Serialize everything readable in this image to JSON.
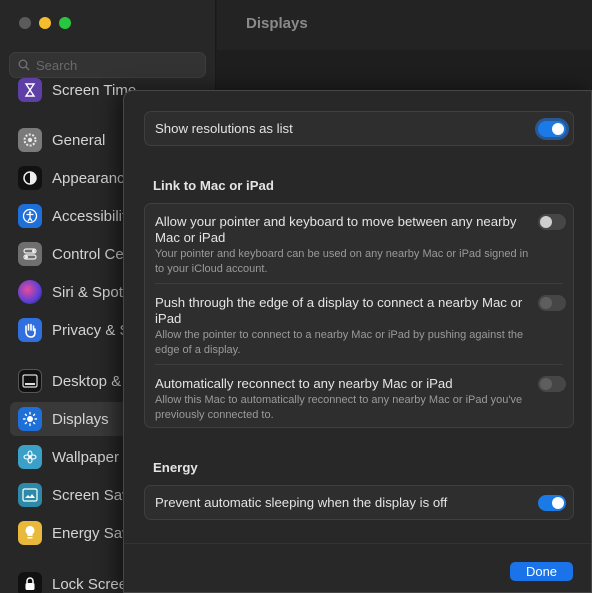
{
  "window": {
    "title": "Displays"
  },
  "search": {
    "placeholder": "Search"
  },
  "sidebar": {
    "items": [
      {
        "label": "Screen Time",
        "icon": "hourglass-icon"
      },
      {
        "label": "General",
        "icon": "gear-icon"
      },
      {
        "label": "Appearance",
        "icon": "appearance-icon"
      },
      {
        "label": "Accessibility",
        "icon": "accessibility-icon"
      },
      {
        "label": "Control Centre",
        "icon": "control-centre-icon"
      },
      {
        "label": "Siri & Spotlight",
        "icon": "siri-icon"
      },
      {
        "label": "Privacy & Security",
        "icon": "hand-icon"
      },
      {
        "label": "Desktop & Dock",
        "icon": "dock-icon"
      },
      {
        "label": "Displays",
        "icon": "display-brightness-icon"
      },
      {
        "label": "Wallpaper",
        "icon": "wallpaper-icon"
      },
      {
        "label": "Screen Saver",
        "icon": "screen-saver-icon"
      },
      {
        "label": "Energy Saver",
        "icon": "lightbulb-icon"
      },
      {
        "label": "Lock Screen",
        "icon": "lock-icon"
      }
    ]
  },
  "sheet": {
    "show_resolutions": {
      "label": "Show resolutions as list",
      "enabled": true
    },
    "link_section": {
      "title": "Link to Mac or iPad",
      "rows": [
        {
          "title": "Allow your pointer and keyboard to move between any nearby Mac or iPad",
          "description": "Your pointer and keyboard can be used on any nearby Mac or iPad signed in to your iCloud account.",
          "enabled": false
        },
        {
          "title": "Push through the edge of a display to connect a nearby Mac or iPad",
          "description": "Allow the pointer to connect to a nearby Mac or iPad by pushing against the edge of a display.",
          "enabled": false
        },
        {
          "title": "Automatically reconnect to any nearby Mac or iPad",
          "description": "Allow this Mac to automatically reconnect to any nearby Mac or iPad you've previously connected to.",
          "enabled": false
        }
      ]
    },
    "energy_section": {
      "title": "Energy",
      "prevent_sleep": {
        "label": "Prevent automatic sleeping when the display is off",
        "enabled": true
      }
    },
    "done_label": "Done"
  },
  "colors": {
    "accent": "#1a7ae6",
    "done_button": "#1a73e8",
    "sheet_bg": "#282828",
    "card_bg": "#2e2e2e"
  }
}
